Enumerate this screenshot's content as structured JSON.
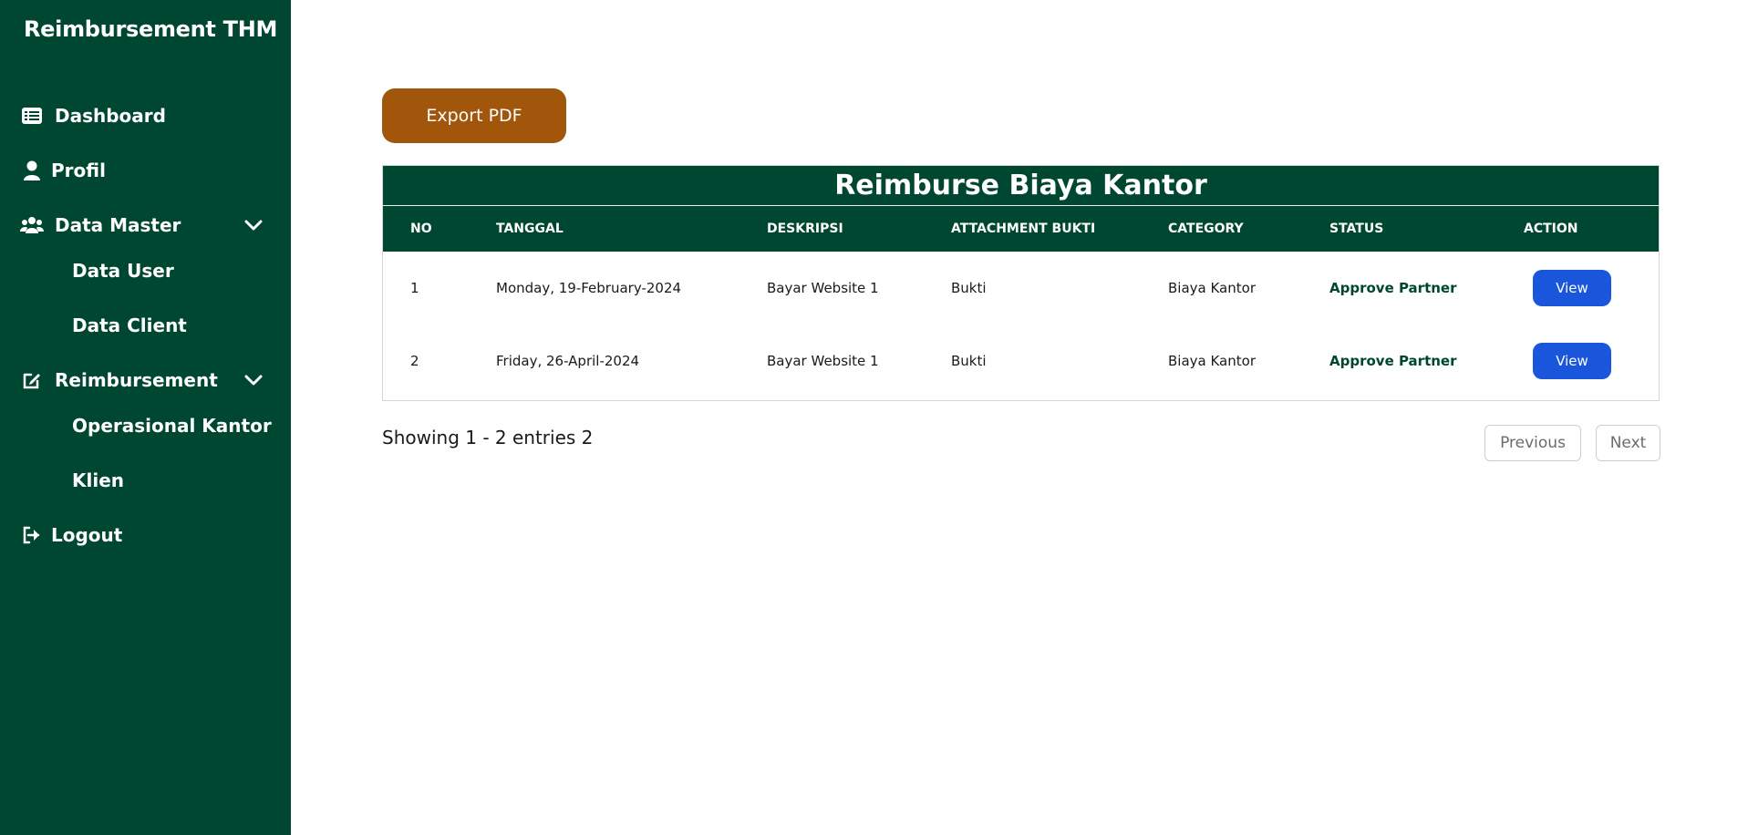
{
  "sidebar": {
    "brand": "Reimbursement THM",
    "items": [
      {
        "label": "Dashboard",
        "icon": "list-icon"
      },
      {
        "label": "Profil",
        "icon": "user-icon"
      },
      {
        "label": "Data Master",
        "icon": "users-icon",
        "expanded": true,
        "children": [
          "Data User",
          "Data Client"
        ]
      },
      {
        "label": "Reimbursement",
        "icon": "edit-icon",
        "expanded": true,
        "children": [
          "Operasional Kantor",
          "Klien"
        ]
      },
      {
        "label": "Logout",
        "icon": "logout-icon"
      }
    ]
  },
  "main": {
    "export_label": "Export PDF",
    "table": {
      "title": "Reimburse Biaya Kantor",
      "headers": [
        "NO",
        "TANGGAL",
        "DESKRIPSI",
        "ATTACHMENT BUKTI",
        "CATEGORY",
        "STATUS",
        "ACTION"
      ],
      "rows": [
        {
          "no": "1",
          "tanggal": "Monday, 19-February-2024",
          "deskripsi": "Bayar Website 1",
          "attachment": "Bukti",
          "category": "Biaya Kantor",
          "status": "Approve Partner",
          "action": "View"
        },
        {
          "no": "2",
          "tanggal": "Friday, 26-April-2024",
          "deskripsi": "Bayar Website 1",
          "attachment": "Bukti",
          "category": "Biaya Kantor",
          "status": "Approve Partner",
          "action": "View"
        }
      ]
    },
    "showing": "Showing 1 - 2 entries 2",
    "pagination": {
      "previous": "Previous",
      "next": "Next"
    }
  },
  "colors": {
    "sidebar_bg": "#004731",
    "export_button": "#a1560c",
    "view_button": "#1a56db",
    "status_text": "#004731"
  }
}
